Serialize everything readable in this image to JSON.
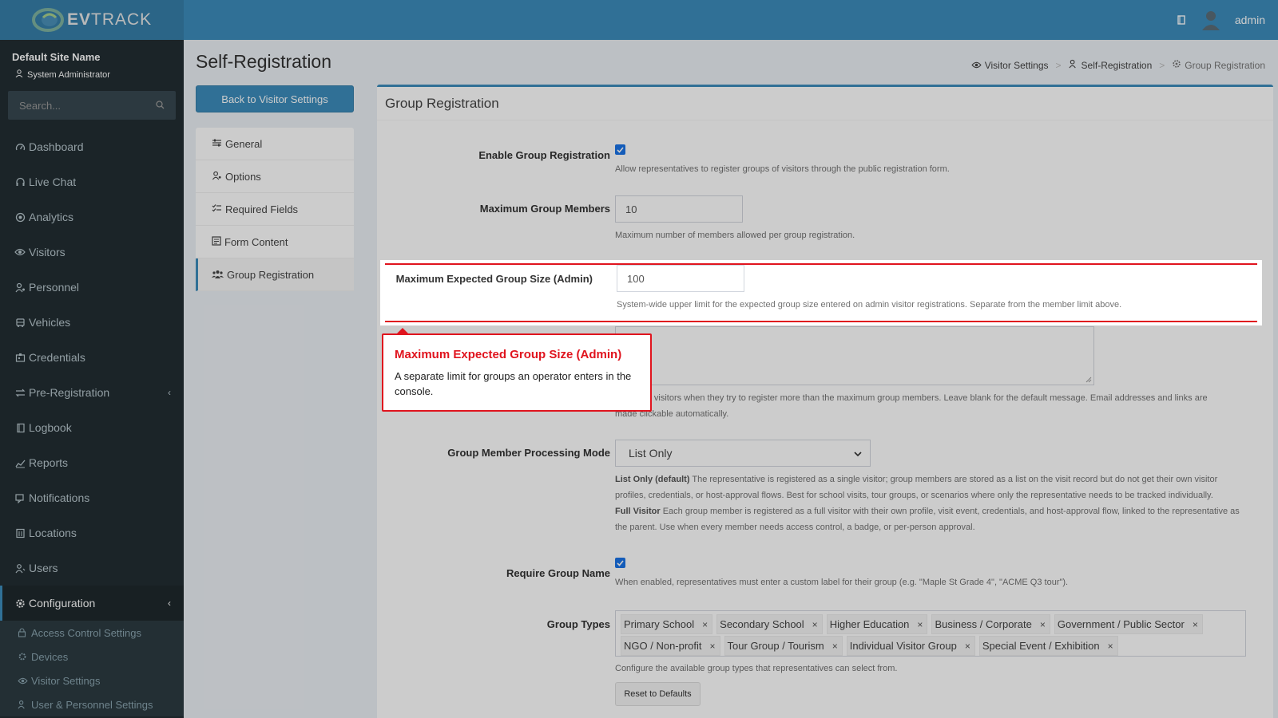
{
  "header": {
    "logo_prefix": "EV",
    "logo_suffix": "TRACK",
    "user_name": "admin",
    "icons": {
      "book": "book-icon",
      "avatar": "avatar-icon"
    }
  },
  "sidebar": {
    "site_name": "Default Site Name",
    "user_role": "System Administrator",
    "search_placeholder": "Search...",
    "items": [
      {
        "label": "Dashboard",
        "icon": "dashboard-icon"
      },
      {
        "label": "Live Chat",
        "icon": "headset-icon"
      },
      {
        "label": "Analytics",
        "icon": "target-icon"
      },
      {
        "label": "Visitors",
        "icon": "eye-icon"
      },
      {
        "label": "Personnel",
        "icon": "user-cog-icon"
      },
      {
        "label": "Vehicles",
        "icon": "bus-icon"
      },
      {
        "label": "Credentials",
        "icon": "badge-icon"
      },
      {
        "label": "Pre-Registration",
        "icon": "exchange-icon"
      },
      {
        "label": "Logbook",
        "icon": "book-icon"
      },
      {
        "label": "Reports",
        "icon": "chart-icon"
      },
      {
        "label": "Notifications",
        "icon": "chat-icon"
      },
      {
        "label": "Locations",
        "icon": "building-icon"
      },
      {
        "label": "Users",
        "icon": "users-icon"
      },
      {
        "label": "Configuration",
        "icon": "gear-icon"
      }
    ],
    "sub_items": [
      {
        "label": "Access Control Settings",
        "icon": "lock-icon"
      },
      {
        "label": "Devices",
        "icon": "device-icon"
      },
      {
        "label": "Visitor Settings",
        "icon": "eye-icon"
      },
      {
        "label": "User & Personnel Settings",
        "icon": "users-icon"
      }
    ]
  },
  "page": {
    "title": "Self-Registration",
    "breadcrumb": [
      "Visitor Settings",
      "Self-Registration",
      "Group Registration"
    ],
    "back_button": "Back to Visitor Settings",
    "subnav": [
      "General",
      "Options",
      "Required Fields",
      "Form Content",
      "Group Registration"
    ],
    "active_subnav": "Group Registration"
  },
  "form": {
    "box_title": "Group Registration",
    "enable_group": {
      "label": "Enable Group Registration",
      "checked": true,
      "help": "Allow representatives to register groups of visitors through the public registration form."
    },
    "max_members": {
      "label": "Maximum Group Members",
      "value": "10",
      "help": "Maximum number of members allowed per group registration."
    },
    "max_expected": {
      "label": "Maximum Expected Group Size (Admin)",
      "value": "100",
      "help": "System-wide upper limit for the expected group size entered on admin visitor registrations. Separate from the member limit above."
    },
    "exceeded_message": {
      "help": "Shown to visitors when they try to register more than the maximum group members. Leave blank for the default message. Email addresses and links are made clickable automatically."
    },
    "processing_mode": {
      "label": "Group Member Processing Mode",
      "selected": "List Only",
      "help_list_title": "List Only (default)",
      "help_list": "The representative is registered as a single visitor; group members are stored as a list on the visit record but do not get their own visitor profiles, credentials, or host-approval flows. Best for school visits, tour groups, or scenarios where only the representative needs to be tracked individually.",
      "help_full_title": "Full Visitor",
      "help_full": "Each group member is registered as a full visitor with their own profile, visit event, credentials, and host-approval flow, linked to the representative as the parent. Use when every member needs access control, a badge, or per-person approval."
    },
    "require_name": {
      "label": "Require Group Name",
      "checked": true,
      "help": "When enabled, representatives must enter a custom label for their group (e.g. \"Maple St Grade 4\", \"ACME Q3 tour\")."
    },
    "group_types": {
      "label": "Group Types",
      "tags": [
        "Primary School",
        "Secondary School",
        "Higher Education",
        "Business / Corporate",
        "Government / Public Sector",
        "NGO / Non-profit",
        "Tour Group / Tourism",
        "Individual Visitor Group",
        "Special Event / Exhibition"
      ],
      "remove_glyph": "×",
      "help": "Configure the available group types that representatives can select from.",
      "reset_button": "Reset to Defaults"
    }
  },
  "tooltip": {
    "title": "Maximum Expected Group Size (Admin)",
    "body": "A separate limit for groups an operator enters in the console."
  },
  "colors": {
    "header": "#3c8dbc",
    "sidebar": "#222d32",
    "highlight": "#e0141e",
    "checkbox": "#1a73e8"
  }
}
